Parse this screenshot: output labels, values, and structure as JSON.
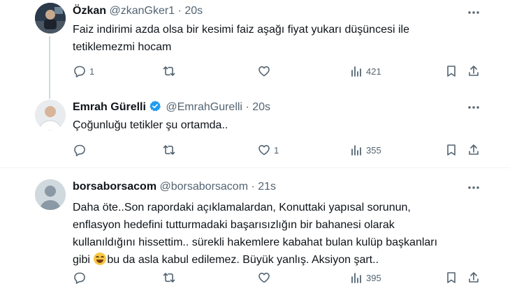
{
  "tweets": [
    {
      "name": "Özkan",
      "handle": "@zkanGker1",
      "separator": "·",
      "time": "20s",
      "lines": [
        "Faiz indirimi azda olsa bir kesimi faiz aşağı fiyat yukarı düşüncesi ile",
        "tetiklemezmi hocam"
      ],
      "replies": "1",
      "retweets": "",
      "likes": "",
      "views": "421"
    },
    {
      "name": "Emrah Gürelli",
      "handle": "@EmrahGurelli",
      "separator": "·",
      "time": "20s",
      "verified": true,
      "lines": [
        "Çoğunluğu tetikler şu ortamda.."
      ],
      "replies": "",
      "retweets": "",
      "likes": "1",
      "views": "355"
    },
    {
      "name": "borsaborsacom",
      "handle": "@borsaborsacom",
      "separator": "·",
      "time": "21s",
      "lines": [
        "Daha öte..Son rapordaki açıklamalardan, Konuttaki yapısal sorunun,",
        "enflasyon hedefini tutturmadaki başarısızlığın bir bahanesi olarak",
        "kullanıldığını hissettim.. sürekli hakemlere kabahat bulan kulüp başkanları",
        "gibi",
        "bu da asla kabul edilemez. Büyük yanlış. Aksiyon şart.."
      ],
      "emoji": "grinning-squinting-face-emoji",
      "replies": "",
      "retweets": "",
      "likes": "",
      "views": "395"
    }
  ],
  "icons": {
    "reply": "reply-icon",
    "retweet": "retweet-icon",
    "like": "heart-icon",
    "views": "views-icon",
    "bookmark": "bookmark-icon",
    "share": "share-icon",
    "more": "more-options-icon",
    "verified": "verified-badge-icon"
  },
  "colors": {
    "text": "#0f1419",
    "secondary": "#536471",
    "verified": "#1d9bf0",
    "thread_line": "#cfd9de",
    "divider": "#eff3f4"
  }
}
